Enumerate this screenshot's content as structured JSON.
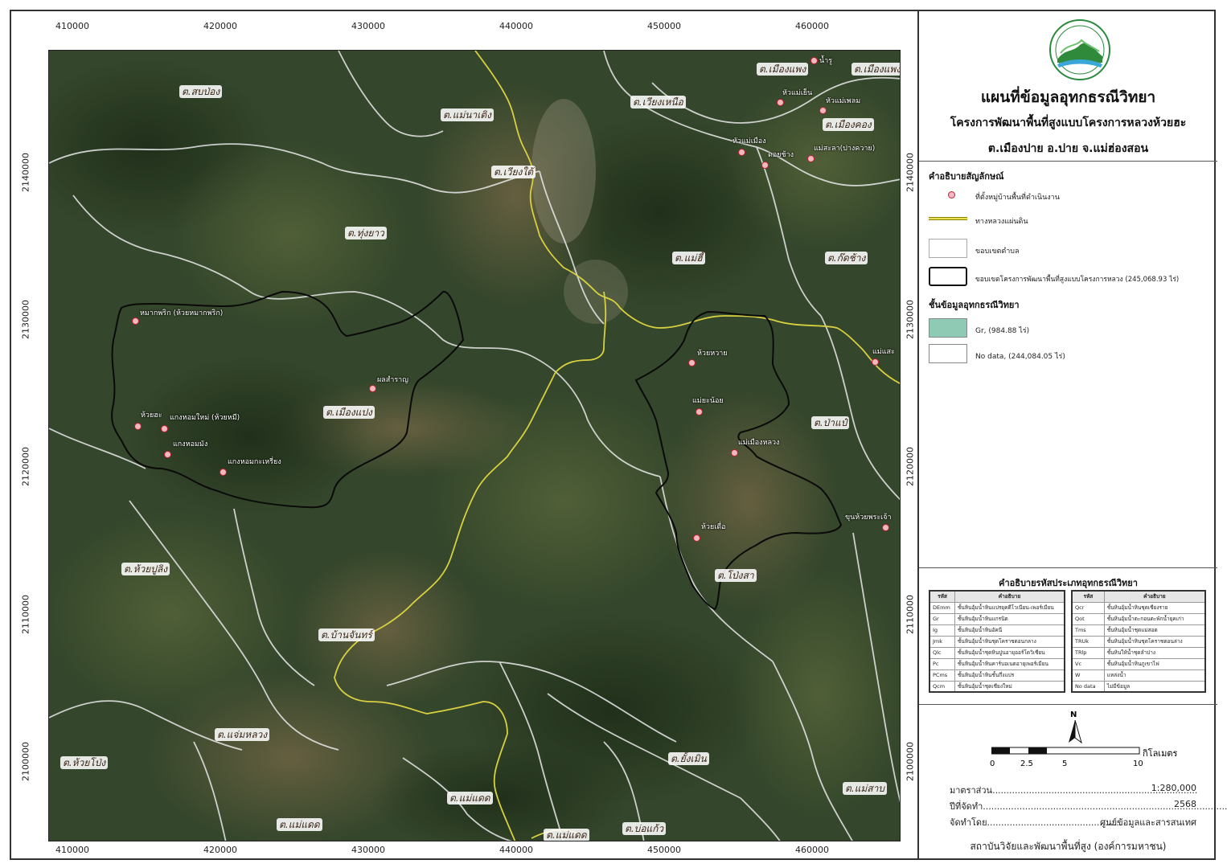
{
  "map": {
    "x_ticks": [
      "410000",
      "420000",
      "430000",
      "440000",
      "450000",
      "460000"
    ],
    "y_ticks": [
      "2140000",
      "2130000",
      "2120000",
      "2110000",
      "2100000"
    ],
    "subdistricts": [
      "ต.สบป่อง",
      "ต.แม่นาเติง",
      "ต.เวียงเหนือ",
      "ต.เมืองแพง",
      "ต.เมืองแพง",
      "ต.เวียงใต้",
      "ต.เมืองคอง",
      "ต.ทุ่งยาว",
      "ต.แม่ฮี้",
      "ต.ก๊ดช้าง",
      "ต.เมืองแปง",
      "ต.ป่าแป๋",
      "ต.ห้วยปูลิง",
      "ต.โป่งสา",
      "ต.บ้านจันทร์",
      "ต.แจ่มหลวง",
      "ต.ยั้งเมิน",
      "ต.ห้วยโป่ง",
      "ต.แม่แดด",
      "ต.แม่สาบ",
      "ต.แม่แดด",
      "ต.แม่แดด",
      "ต.บ่อแก้ว"
    ],
    "villages": [
      "น้ำรู",
      "หัวแม่เย็น",
      "หัวแม่เพลม",
      "หัวแม่เมือง",
      "ดอยช้าง",
      "แม่สะลา(ปางควาย)",
      "หมากพริก (ห้วยหมากพริก)",
      "ผลสำราญ",
      "ห้วยฮะ",
      "แกงหอมใหม่ (ห้วยหมี)",
      "แกงหอมมัง",
      "แกงหอมกะเหรี่ยง",
      "ห้วยหวาย",
      "แม่ยะน้อย",
      "แม่เมืองหลวง",
      "ห้วยเดื่อ",
      "แม่แสะ",
      "ขุนห้วยพระเจ้า"
    ]
  },
  "header": {
    "title": "แผนที่ข้อมูลอุทกธรณีวิทยา",
    "subtitle": "โครงการพัฒนาพื้นที่สูงแบบโครงการหลวงห้วยฮะ",
    "location": "ต.เมืองปาย อ.ปาย จ.แม่ฮ่องสอน"
  },
  "legend": {
    "title": "คำอธิบายสัญลักษณ์",
    "village": "ที่ตั้งหมู่บ้านพื้นที่ดำเนินงาน",
    "highway": "ทางหลวงแผ่นดิน",
    "subdistrict_boundary": "ขอบเขตตำบล",
    "project_boundary": "ขอบเขตโครงการพัฒนาพื้นที่สูงแบบโครงการหลวง (245,068.93 ไร่)",
    "layer_title": "ชั้นข้อมูลอุทกธรณีวิทยา",
    "gr": "Gr, (984.88 ไร่)",
    "nodata": "No data, (244,084.05 ไร่)",
    "colors": {
      "gr": "#8fcbb4",
      "highway": "#d8d040",
      "village": "#c02030"
    }
  },
  "codes": {
    "title": "คำอธิบายรหัสประเภทอุทกธรณีวิทยา",
    "header_code": "รหัส",
    "header_desc": "คำอธิบาย",
    "left": [
      [
        "DEmm",
        "ชั้นหินอุ้มน้ำหินแปรยุคดีโวเนียน-เพอร์เมียน"
      ],
      [
        "Gr",
        "ชั้นหินอุ้มน้ำหินแกรนิต"
      ],
      [
        "Ig",
        "ชั้นหินอุ้มน้ำหินอัคนี"
      ],
      [
        "Jmk",
        "ชั้นหินอุ้มน้ำหินชุดโคราชตอนกลาง"
      ],
      [
        "Qlc",
        "ชั้นหินอุ้มน้ำชุดหินปูนอายุออร์โดวิเชียน"
      ],
      [
        "Pc",
        "ชั้นหินอุ้มน้ำหินคาร์บอเนตอายุเพอร์เมียน"
      ],
      [
        "PCms",
        "ชั้นหินอุ้มน้ำหินชั้นกึ่งแปร"
      ],
      [
        "Qcm",
        "ชั้นหินอุ้มน้ำชุดเชียงใหม่"
      ]
    ],
    "right": [
      [
        "Qcr",
        "ชั้นหินอุ้มน้ำหินชุดเชียงราย"
      ],
      [
        "Qot",
        "ชั้นหินอุ้มน้ำตะกอนตะพักน้ำยุคเก่า"
      ],
      [
        "Tms",
        "ชั้นหินอุ้มน้ำชุดแม่สอด"
      ],
      [
        "TRUk",
        "ชั้นหินอุ้มน้ำหินชุดโคราชตอนล่าง"
      ],
      [
        "TRlp",
        "ชั้นหินให้น้ำชุดลำปาง"
      ],
      [
        "Vc",
        "ชั้นหินอุ้มน้ำหินภูเขาไฟ"
      ],
      [
        "W",
        "แหล่งน้ำ"
      ],
      [
        "No data",
        "ไม่มีข้อมูล"
      ]
    ]
  },
  "scale": {
    "north": "N",
    "ticks": [
      "0",
      "2.5",
      "5",
      "10"
    ],
    "unit": "กิโลเมตร"
  },
  "meta": {
    "ratio_label": "มาตราส่วน.........................................................................",
    "ratio_value": "1:280,000",
    "year_label": "ปีที่จัดทำ..........................................................................................",
    "year_value": "2568",
    "by_label": "จัดทำโดย................................................",
    "by_value": "ศูนย์ข้อมูลและสารสนเทศ",
    "org": "สถาบันวิจัยและพัฒนาพื้นที่สูง (องค์การมหาชน)"
  }
}
